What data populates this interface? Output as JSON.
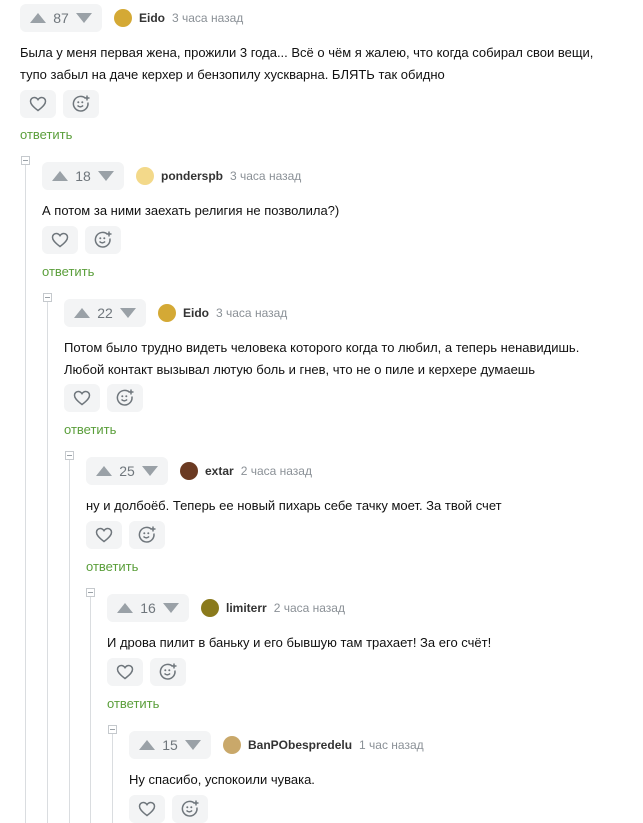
{
  "comments": [
    {
      "votes": "87",
      "author": "Eido",
      "time": "3 часа назад",
      "avatar_color": "#d4a935",
      "text_lines": [
        "Была у меня первая жена, прожили 3 года... Всё о чём я жалею, что когда собирал свои вещи,",
        "тупо забыл на даче керхер и бензопилу хускварна. БЛЯТЬ так обидно"
      ],
      "reply": "ответить"
    },
    {
      "votes": "18",
      "author": "ponderspb",
      "time": "3 часа назад",
      "avatar_color": "#f3d98a",
      "text_lines": [
        "А потом за ними заехать религия не позволила?)"
      ],
      "reply": "ответить"
    },
    {
      "votes": "22",
      "author": "Eido",
      "time": "3 часа назад",
      "avatar_color": "#d4a935",
      "text_lines": [
        "Потом было трудно видеть человека которого когда то любил, а теперь ненавидишь.",
        "Любой контакт вызывал лютую боль и гнев, что не о пиле и керхере думаешь"
      ],
      "reply": "ответить"
    },
    {
      "votes": "25",
      "author": "extar",
      "time": "2 часа назад",
      "avatar_color": "#6b3a22",
      "text_lines": [
        "ну и долбоёб. Теперь ее новый пихарь себе тачку моет. За твой счет"
      ],
      "reply": "ответить"
    },
    {
      "votes": "16",
      "author": "limiterr",
      "time": "2 часа назад",
      "avatar_color": "#8a7a1c",
      "text_lines": [
        "И дрова пилит в баньку и его бывшую там трахает! За его счёт!"
      ],
      "reply": "ответить"
    },
    {
      "votes": "15",
      "author": "BanPObespredelu",
      "time": "1 час назад",
      "avatar_color": "#c9a86a",
      "text_lines": [
        "Ну спасибо, успокоили чувака."
      ],
      "reply": ""
    }
  ],
  "icons": {
    "like": "heart-icon",
    "react": "emoji-add-icon",
    "upvote": "arrow-up-icon",
    "downvote": "arrow-down-icon",
    "collapse": "collapse-minus-icon"
  }
}
